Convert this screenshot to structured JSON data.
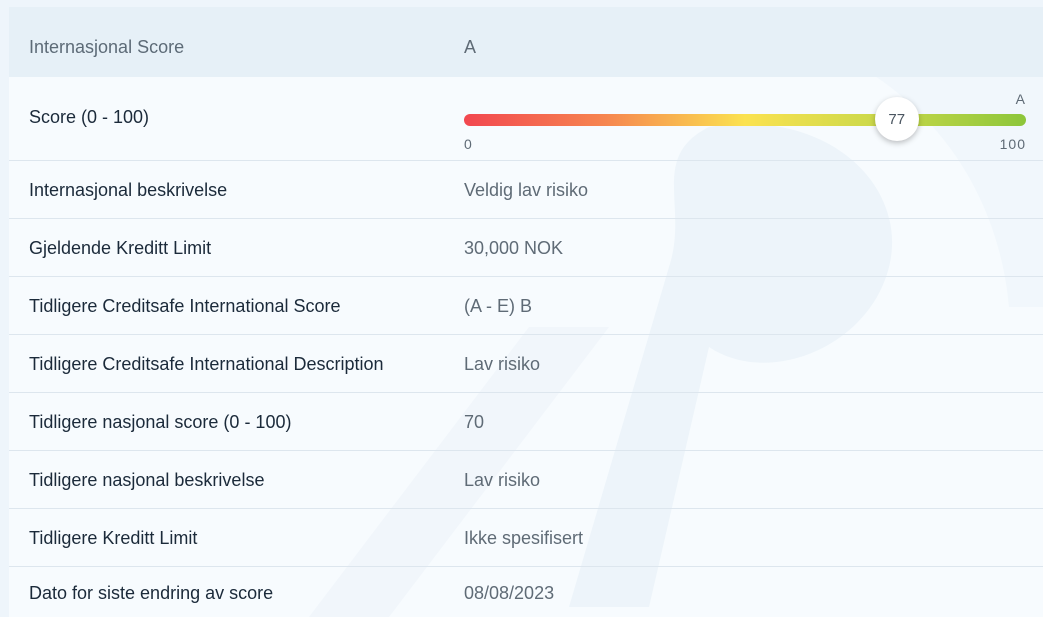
{
  "header": {
    "label": "Internasjonal Score",
    "value": "A"
  },
  "score": {
    "label": "Score (0 - 100)",
    "value": 77,
    "value_text": "77",
    "min_text": "0",
    "max_text": "100",
    "grade": "A",
    "gradient_colors": [
      "#f2474f",
      "#f6854f",
      "#fbe250",
      "#c8d84a",
      "#8dc63a"
    ]
  },
  "rows": [
    {
      "label": "Internasjonal beskrivelse",
      "value": "Veldig lav risiko"
    },
    {
      "label": "Gjeldende Kreditt Limit",
      "value": "30,000 NOK"
    },
    {
      "label": "Tidligere Creditsafe International Score",
      "value": "(A - E) B"
    },
    {
      "label": "Tidligere Creditsafe International Description",
      "value": "Lav risiko"
    },
    {
      "label": "Tidligere nasjonal score (0 - 100)",
      "value": "70"
    },
    {
      "label": "Tidligere nasjonal beskrivelse",
      "value": "Lav risiko"
    },
    {
      "label": "Tidligere Kreditt Limit",
      "value": "Ikke spesifisert"
    },
    {
      "label": "Dato for siste endring av score",
      "value": "08/08/2023"
    }
  ]
}
